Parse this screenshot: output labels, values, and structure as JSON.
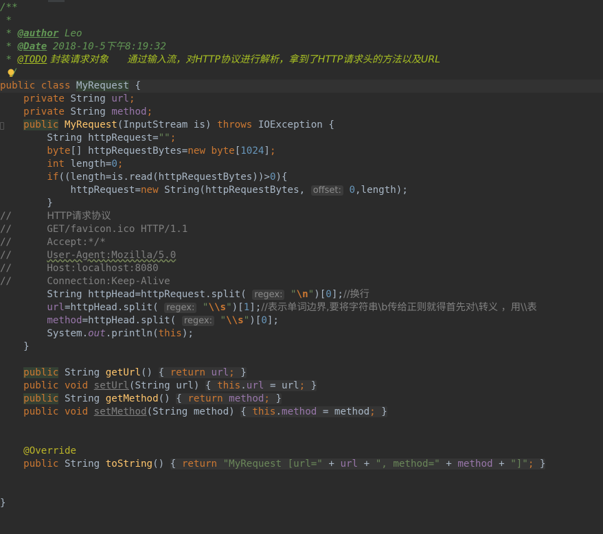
{
  "doc": {
    "open": "/**",
    "star": " *",
    "author_tag": "@author",
    "author": " Leo",
    "date_tag": "@Date",
    "date": " 2018-10-5下午8:19:32",
    "todo_tag": "@TODO",
    "todo_text": " 封装请求对象      通过输入流，对HTTP协议进行解析，拿到了HTTP请求头的方法以及URL",
    "close": "/"
  },
  "class_decl": {
    "mods": "public class ",
    "name": "MyRequest",
    "rest": " {"
  },
  "fields": [
    {
      "kw": "private",
      "type": " String ",
      "name": "url"
    },
    {
      "kw": "private",
      "type": " String ",
      "name": "method"
    }
  ],
  "ctor": {
    "kw": "public",
    "name": "MyRequest",
    "params": "(InputStream is) ",
    "throws": "throws",
    "exc": " IOException {"
  },
  "body": {
    "l1_type": "String httpRequest=",
    "l1_str": "\"\"",
    "l2_kw": "byte",
    "l2_mid": "[] httpRequestBytes=",
    "l2_new": "new",
    "l2_byte": "byte",
    "l2_num": "1024",
    "l3_kw": "int",
    "l3_mid": " length=",
    "l3_num": "0",
    "l4_if": "if",
    "l4_mid": "((length=is.read(httpRequestBytes))>",
    "l4_num": "0",
    "l4_end": "){",
    "l5_pre": "httpRequest=",
    "l5_new": "new",
    "l5_mid": " String(httpRequestBytes, ",
    "l5_hint": "offset:",
    "l5_num": "0",
    "l5_end": ",length);",
    "close_brace": "}"
  },
  "commented": [
    {
      "mark": "//",
      "text": "HTTP请求协议"
    },
    {
      "mark": "//",
      "text": "GET/favicon.ico HTTP/1.1"
    },
    {
      "mark": "//",
      "text": "Accept:*/*"
    },
    {
      "mark": "//",
      "text": "User-Agent:Mozilla/5.0"
    },
    {
      "mark": "//",
      "text": "Host:localhost:8080"
    },
    {
      "mark": "//",
      "text": "Connection:Keep-Alive"
    }
  ],
  "parse": {
    "p1_pre": "String httpHead=httpRequest.split( ",
    "p1_hint": "regex:",
    "p1_q1": "\"",
    "p1_esc": "\\n",
    "p1_q2": "\"",
    "p1_idx1": ")[",
    "p1_num": "0",
    "p1_idx2": "];",
    "p1_cmt": "//换行",
    "p2_pre": "url",
    "p2_mid": "=httpHead.split( ",
    "p2_hint": "regex:",
    "p2_esc": "\\\\s",
    "p2_num": "1",
    "p2_cmt": "//表示单词边界,要将字符串\\b传给正则就得首先对\\转义 ，用\\\\表",
    "p3_pre": "method",
    "p3_mid": "=httpHead.split( ",
    "p3_hint": "regex:",
    "p3_esc": "\\\\s",
    "p3_num": "0",
    "p4_pre": "System.",
    "p4_out": "out",
    "p4_mid": ".println(",
    "p4_this": "this",
    "p4_end": ");"
  },
  "methods": [
    {
      "mods": "public",
      "type": " String ",
      "name": "getUrl",
      "sig": "() ",
      "body_kw": "return",
      "body_field": "url",
      "unused": false
    },
    {
      "mods": "public",
      "type": " void ",
      "name": "setUrl",
      "sig": "(String url) ",
      "body_kw": "this",
      "body_field": "url",
      "unused": true
    },
    {
      "mods": "public",
      "type": " String ",
      "name": "getMethod",
      "sig": "() ",
      "body_kw": "return",
      "body_field": "method",
      "unused": false
    },
    {
      "mods": "public",
      "type": " void ",
      "name": "setMethod",
      "sig": "(String method) ",
      "body_kw": "this",
      "body_field": "method",
      "unused": true
    }
  ],
  "override": "@Override",
  "tostring": {
    "mods": "public",
    "type": " String ",
    "name": "toString",
    "ret": "return",
    "s1": "\"MyRequest [url=\"",
    "s2": "\", method=\"",
    "s3": "\"]\""
  },
  "end_brace": "}"
}
